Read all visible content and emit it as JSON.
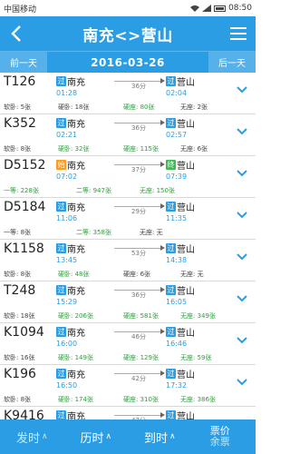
{
  "status": {
    "carrier": "中国移动",
    "time": "08:50"
  },
  "header": {
    "title": "南充<>营山"
  },
  "datebar": {
    "prev_label": "前一天",
    "date": "2016-03-26",
    "next_label": "后一天"
  },
  "trains": [
    {
      "code": "T126",
      "from": "南充",
      "from_badge": "过",
      "from_type": "pass",
      "to": "营山",
      "to_badge": "过",
      "to_type": "pass",
      "dep": "01:28",
      "arr": "02:04",
      "duration": "36分",
      "seats": [
        {
          "text": "软卧: 5张"
        },
        {
          "text": "硬卧: 18张"
        },
        {
          "text": "硬座: 80张",
          "green": true
        },
        {
          "text": "无座: 2张"
        }
      ]
    },
    {
      "code": "K352",
      "from": "南充",
      "from_badge": "过",
      "from_type": "pass",
      "to": "营山",
      "to_badge": "过",
      "to_type": "pass",
      "dep": "02:21",
      "arr": "02:57",
      "duration": "36分",
      "seats": [
        {
          "text": "软卧: 8张"
        },
        {
          "text": "硬卧: 32张",
          "green": true
        },
        {
          "text": "硬座: 115张",
          "green": true
        },
        {
          "text": "无座: 6张"
        }
      ]
    },
    {
      "code": "D5152",
      "from": "南充",
      "from_badge": "始",
      "from_type": "start",
      "to": "营山",
      "to_badge": "终",
      "to_type": "end",
      "dep": "07:02",
      "arr": "07:39",
      "duration": "37分",
      "seats": [
        {
          "text": "一等: 228张",
          "green": true
        },
        {
          "text": "二等: 947张",
          "green": true
        },
        {
          "text": "无座: 150张",
          "green": true
        }
      ]
    },
    {
      "code": "D5184",
      "from": "南充",
      "from_badge": "过",
      "from_type": "pass",
      "to": "营山",
      "to_badge": "过",
      "to_type": "pass",
      "dep": "11:06",
      "arr": "11:35",
      "duration": "29分",
      "seats": [
        {
          "text": "一等: 8张"
        },
        {
          "text": "二等: 358张",
          "green": true
        },
        {
          "text": "无座: 无"
        }
      ]
    },
    {
      "code": "K1158",
      "from": "南充",
      "from_badge": "过",
      "from_type": "pass",
      "to": "营山",
      "to_badge": "过",
      "to_type": "pass",
      "dep": "13:45",
      "arr": "14:38",
      "duration": "53分",
      "seats": [
        {
          "text": "软卧: 8张"
        },
        {
          "text": "硬卧: 48张",
          "green": true
        },
        {
          "text": "硬座: 6张"
        },
        {
          "text": "无座: 无"
        }
      ]
    },
    {
      "code": "T248",
      "from": "南充",
      "from_badge": "过",
      "from_type": "pass",
      "to": "营山",
      "to_badge": "过",
      "to_type": "pass",
      "dep": "15:29",
      "arr": "16:05",
      "duration": "36分",
      "seats": [
        {
          "text": "软卧: 18张"
        },
        {
          "text": "硬卧: 206张",
          "green": true
        },
        {
          "text": "硬座: 581张",
          "green": true
        },
        {
          "text": "无座: 349张",
          "green": true
        }
      ]
    },
    {
      "code": "K1094",
      "from": "南充",
      "from_badge": "过",
      "from_type": "pass",
      "to": "营山",
      "to_badge": "过",
      "to_type": "pass",
      "dep": "16:00",
      "arr": "16:46",
      "duration": "46分",
      "seats": [
        {
          "text": "软卧: 16张"
        },
        {
          "text": "硬卧: 149张",
          "green": true
        },
        {
          "text": "硬座: 129张",
          "green": true
        },
        {
          "text": "无座: 59张",
          "green": true
        }
      ]
    },
    {
      "code": "K196",
      "from": "南充",
      "from_badge": "过",
      "from_type": "pass",
      "to": "营山",
      "to_badge": "过",
      "to_type": "pass",
      "dep": "16:50",
      "arr": "17:32",
      "duration": "42分",
      "seats": [
        {
          "text": "软卧: 8张"
        },
        {
          "text": "硬卧: 174张",
          "green": true
        },
        {
          "text": "硬座: 310张",
          "green": true
        },
        {
          "text": "无座: 386张",
          "green": true
        }
      ]
    },
    {
      "code": "K9416",
      "from": "南充",
      "from_badge": "过",
      "from_type": "pass",
      "to": "营山",
      "to_badge": "过",
      "to_type": "pass",
      "dep": "",
      "arr": "",
      "duration": "47分",
      "partial": true,
      "seats": []
    }
  ],
  "bottom": {
    "depart": "发时",
    "duration": "历时",
    "arrive": "到时",
    "price": "票价",
    "remaining": "余票"
  }
}
